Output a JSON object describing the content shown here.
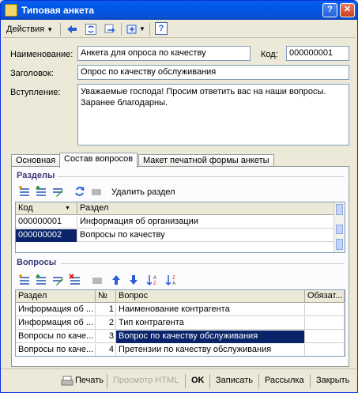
{
  "window": {
    "title": "Типовая анкета",
    "help_label": "?",
    "close_label": "✕"
  },
  "toolbar": {
    "actions_label": "Действия",
    "help_label": "?"
  },
  "form": {
    "name_label": "Наименование:",
    "name_value": "Анкета для опроса по качеству",
    "code_label": "Код:",
    "code_value": "000000001",
    "heading_label": "Заголовок:",
    "heading_value": "Опрос по качеству обслуживания",
    "intro_label": "Вступление:",
    "intro_value": "Уважаемые господа! Просим ответить вас на наши вопросы. Заранее благодарны."
  },
  "tabs": [
    "Основная",
    "Состав вопросов",
    "Макет печатной формы анкеты"
  ],
  "sections": {
    "title": "Разделы",
    "delete_label": "Удалить раздел",
    "columns": [
      "Код",
      "Раздел"
    ],
    "rows": [
      {
        "code": "000000001",
        "name": "Информация об организации"
      },
      {
        "code": "000000002",
        "name": "Вопросы по качеству"
      }
    ]
  },
  "questions": {
    "title": "Вопросы",
    "columns": [
      "Раздел",
      "№",
      "Вопрос",
      "Обязат..."
    ],
    "rows": [
      {
        "section": "Информация об ...",
        "num": "1",
        "question": "Наименование контрагента",
        "req": ""
      },
      {
        "section": "Информация об ...",
        "num": "2",
        "question": "Тип контрагента",
        "req": ""
      },
      {
        "section": "Вопросы по каче...",
        "num": "3",
        "question": "Вопрос по качеству обслуживания",
        "req": ""
      },
      {
        "section": "Вопросы по каче...",
        "num": "4",
        "question": "Претензии по качеству обслуживания",
        "req": ""
      }
    ]
  },
  "footer": {
    "print_label": "Печать",
    "preview_label": "Просмотр HTML",
    "ok_label": "OK",
    "save_label": "Записать",
    "mail_label": "Рассылка",
    "close_label": "Закрыть"
  },
  "colors": {
    "selection": "#0a246a",
    "title_bar": "#0058e6",
    "section_title": "#3a3a78"
  }
}
